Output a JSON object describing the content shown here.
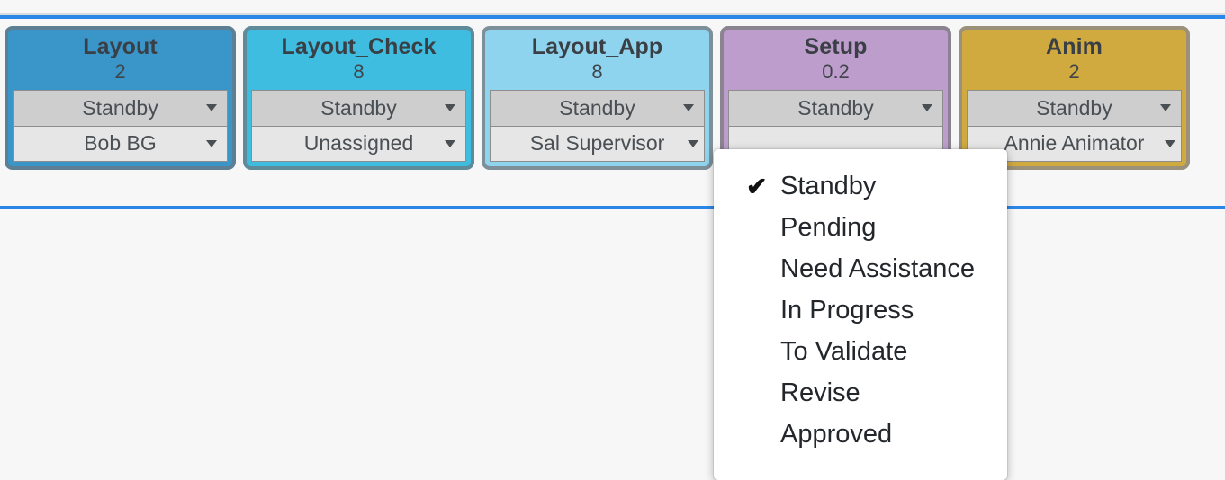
{
  "colors": {
    "page_background": "#f7f7f8",
    "rule_blue": "#2a87e8",
    "rule_gray": "#d9dcdf",
    "status_field_gray": "#cecece",
    "assignee_field_gray": "#e6e6e6",
    "menu_background": "#ffffff",
    "text_dark": "#3a3f45"
  },
  "board": {
    "cards": [
      {
        "title": "Layout",
        "count": "2",
        "status": "Standby",
        "assignee": "Bob BG",
        "fill": "#3a95c9",
        "border": "#5c7f93"
      },
      {
        "title": "Layout_Check",
        "count": "8",
        "status": "Standby",
        "assignee": "Unassigned",
        "fill": "#3ebde0",
        "border": "#5f8a99"
      },
      {
        "title": "Layout_App",
        "count": "8",
        "status": "Standby",
        "assignee": "Sal Supervisor",
        "fill": "#8fd4ee",
        "border": "#7d8f98"
      },
      {
        "title": "Setup",
        "count": "0.2",
        "status": "Standby",
        "assignee": "",
        "fill": "#bd9dcc",
        "border": "#8a8490"
      },
      {
        "title": "Anim",
        "count": "2",
        "status": "Standby",
        "assignee": "Annie Animator",
        "fill": "#d0a93f",
        "border": "#9b9079"
      }
    ]
  },
  "status_menu": {
    "selected": "Standby",
    "check_glyph": "✔",
    "items": [
      {
        "label": "Standby",
        "checked": true
      },
      {
        "label": "Pending",
        "checked": false
      },
      {
        "label": "Need Assistance",
        "checked": false
      },
      {
        "label": "In Progress",
        "checked": false
      },
      {
        "label": "To Validate",
        "checked": false
      },
      {
        "label": "Revise",
        "checked": false
      },
      {
        "label": "Approved",
        "checked": false
      }
    ]
  }
}
